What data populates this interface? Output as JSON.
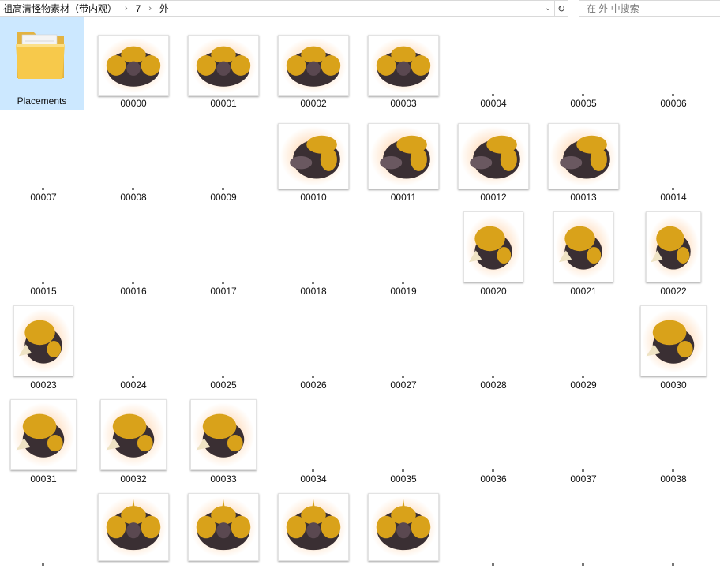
{
  "address_bar": {
    "crumbs": [
      "祖高清怪物素材（带内观）",
      "7",
      "外"
    ],
    "dropdown_icon": "chevron-down-icon",
    "refresh_icon": "refresh-icon"
  },
  "search": {
    "placeholder": "在 外 中搜索",
    "value": ""
  },
  "folder": {
    "name": "Placements",
    "icon": "folder-icon"
  },
  "files": [
    {
      "name": "00000",
      "thumb": "front"
    },
    {
      "name": "00001",
      "thumb": "front"
    },
    {
      "name": "00002",
      "thumb": "front"
    },
    {
      "name": "00003",
      "thumb": "front"
    },
    {
      "name": "00004",
      "thumb": "blank"
    },
    {
      "name": "00005",
      "thumb": "blank"
    },
    {
      "name": "00006",
      "thumb": "blank"
    },
    {
      "name": "00007",
      "thumb": "blank"
    },
    {
      "name": "00008",
      "thumb": "blank"
    },
    {
      "name": "00009",
      "thumb": "blank"
    },
    {
      "name": "00010",
      "thumb": "diag"
    },
    {
      "name": "00011",
      "thumb": "diag"
    },
    {
      "name": "00012",
      "thumb": "diag"
    },
    {
      "name": "00013",
      "thumb": "diag"
    },
    {
      "name": "00014",
      "thumb": "blank"
    },
    {
      "name": "00015",
      "thumb": "blank"
    },
    {
      "name": "00016",
      "thumb": "blank"
    },
    {
      "name": "00017",
      "thumb": "blank"
    },
    {
      "name": "00018",
      "thumb": "blank"
    },
    {
      "name": "00019",
      "thumb": "blank"
    },
    {
      "name": "00020",
      "thumb": "side"
    },
    {
      "name": "00021",
      "thumb": "side"
    },
    {
      "name": "00022",
      "thumb": "side"
    },
    {
      "name": "00023",
      "thumb": "side"
    },
    {
      "name": "00024",
      "thumb": "blank"
    },
    {
      "name": "00025",
      "thumb": "blank"
    },
    {
      "name": "00026",
      "thumb": "blank"
    },
    {
      "name": "00027",
      "thumb": "blank"
    },
    {
      "name": "00028",
      "thumb": "blank"
    },
    {
      "name": "00029",
      "thumb": "blank"
    },
    {
      "name": "00030",
      "thumb": "rear"
    },
    {
      "name": "00031",
      "thumb": "rear"
    },
    {
      "name": "00032",
      "thumb": "rear"
    },
    {
      "name": "00033",
      "thumb": "rear"
    },
    {
      "name": "00034",
      "thumb": "blank"
    },
    {
      "name": "00035",
      "thumb": "blank"
    },
    {
      "name": "00036",
      "thumb": "blank"
    },
    {
      "name": "00037",
      "thumb": "blank"
    },
    {
      "name": "00038",
      "thumb": "blank"
    },
    {
      "name": "",
      "thumb": "blank"
    },
    {
      "name": "",
      "thumb": "back"
    },
    {
      "name": "",
      "thumb": "back"
    },
    {
      "name": "",
      "thumb": "back"
    },
    {
      "name": "",
      "thumb": "back"
    },
    {
      "name": "",
      "thumb": "blank"
    },
    {
      "name": "",
      "thumb": "blank"
    },
    {
      "name": "",
      "thumb": "blank"
    }
  ],
  "colors": {
    "selection": "#cce8ff",
    "gold": "#d9a21a",
    "glow": "#ff9a3a",
    "dark": "#3a2f33"
  }
}
